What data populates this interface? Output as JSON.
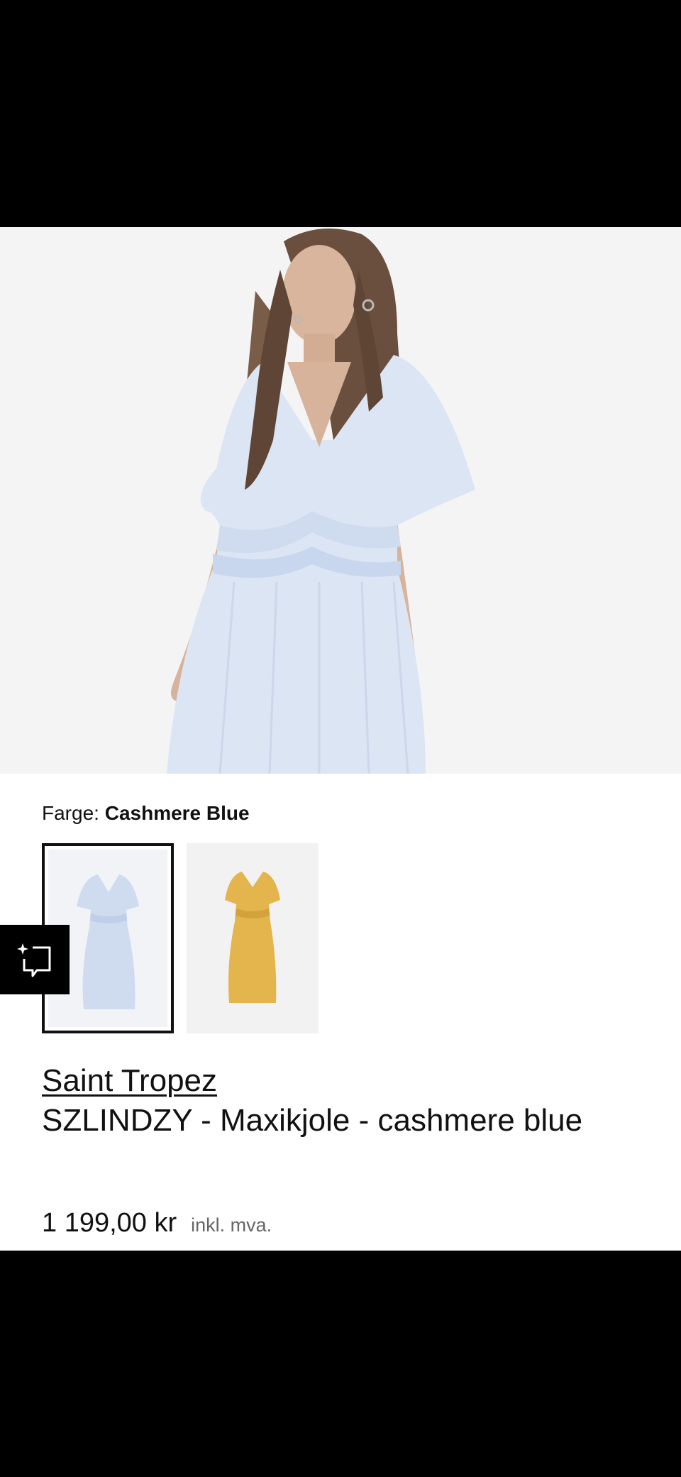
{
  "product": {
    "color_label": "Farge:",
    "color_value": "Cashmere Blue",
    "brand": "Saint Tropez",
    "name": "SZLINDZY - Maxikjole - cashmere blue",
    "price": "1 199,00 kr",
    "vat_note": "inkl. mva."
  },
  "swatches": [
    {
      "name": "cashmere blue",
      "color": "#dce6f4",
      "selected": true
    },
    {
      "name": "yellow",
      "color": "#e3b54c",
      "selected": false
    }
  ],
  "icons": {
    "feedback": "sparkle-feedback-icon"
  },
  "colors": {
    "hero_background": "#f4f4f4",
    "dress": "#dbe5f4",
    "text": "#111111"
  }
}
